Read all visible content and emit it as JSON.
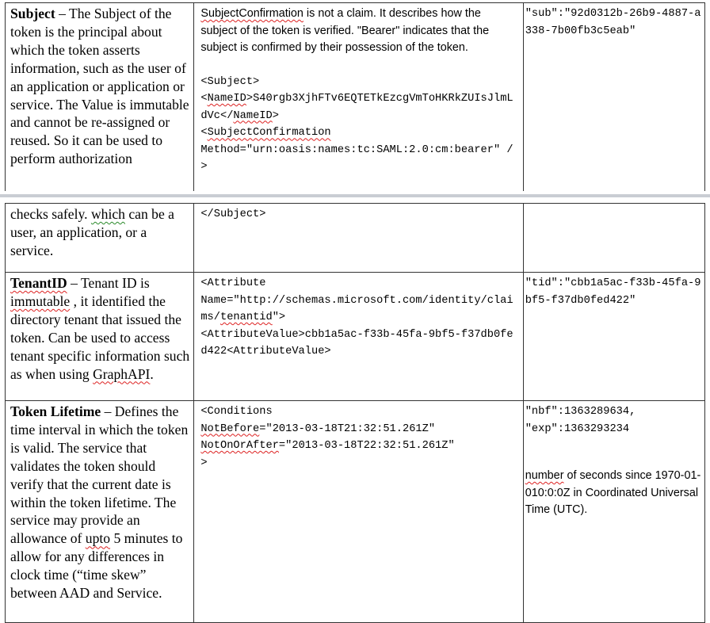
{
  "table1": {
    "subject": {
      "term": "Subject",
      "dash": " – ",
      "desc": "The Subject of the token is the principal about which the token asserts information, such as the user of an application or application or service. The Value is immutable and cannot be re-assigned or reused. So it can be used to perform authorization",
      "explain_link": "SubjectConfirmation",
      "explain_rest": " is not a claim. It describes how the subject of the token is verified. \"Bearer\" indicates that the subject is confirmed by their possession of the token.",
      "xml_open": "<Subject>",
      "xml_nameid_lt": "<",
      "xml_nameid_tag": "NameID",
      "xml_nameid_value": ">S40rgb3XjhFTv6EQTETkEzcgVmToHKRkZUIsJlmLdVc</",
      "xml_nameid_close_tag": "NameID",
      "xml_nameid_end": ">",
      "xml_sc_lt": "<",
      "xml_sc_tag": "SubjectConfirmation",
      "xml_sc_method": "Method=\"urn:oasis:names:tc:SAML:2.0:cm:bearer\" />",
      "jwt": "\"sub\":\"92d0312b-26b9-4887-a338-7b00fb3c5eab\""
    }
  },
  "table2": {
    "subject_cont": {
      "desc_a": "checks safely. ",
      "desc_b": "which",
      "desc_c": " can be a user, an application, or a service.",
      "xml_close": "</Subject>"
    },
    "tenant": {
      "term": "TenantID",
      "dash": " – Tenant ID is ",
      "immutable": "immutable",
      "desc_mid": " , it identified the directory tenant that issued the token. Can be used to access tenant specific information such as when using ",
      "graph": "GraphAPI",
      "desc_end": ".",
      "xml_attr_open": "<Attribute",
      "xml_attr_name_a": "Name=\"http://schemas.microsoft.com/identity/claims/",
      "xml_attr_name_b": "tenantid",
      "xml_attr_name_c": "\">",
      "xml_attr_value": "<AttributeValue>cbb1a5ac-f33b-45fa-9bf5-f37db0fed422<AttributeValue>",
      "jwt": "\"tid\":\"cbb1a5ac-f33b-45fa-9bf5-f37db0fed422\""
    },
    "lifetime": {
      "term": "Token Lifetime",
      "dash": " – ",
      "desc_a": "Defines the time interval in which the token is valid. The service that validates the token should verify that the current date is within the token lifetime. The service may provide an allowance of ",
      "upto": "upto",
      "desc_b": " 5 minutes to allow for any differences in clock time (“time skew” between AAD and Service.",
      "xml_cond": "<Conditions",
      "xml_nb_a": "NotBefore",
      "xml_nb_b": "=\"2013-03-18T21:32:51.261Z\"",
      "xml_na_a": "NotOnOrAfter",
      "xml_na_b": "=\"2013-03-18T22:32:51.261Z\"",
      "xml_gt": ">",
      "jwt_nbf": "\"nbf\":1363289634,",
      "jwt_exp": "\"exp\":1363293234",
      "note_a": "number",
      "note_b": " of seconds since 1970-01-010:0:0Z in Coordinated Universal Time (UTC)."
    }
  }
}
